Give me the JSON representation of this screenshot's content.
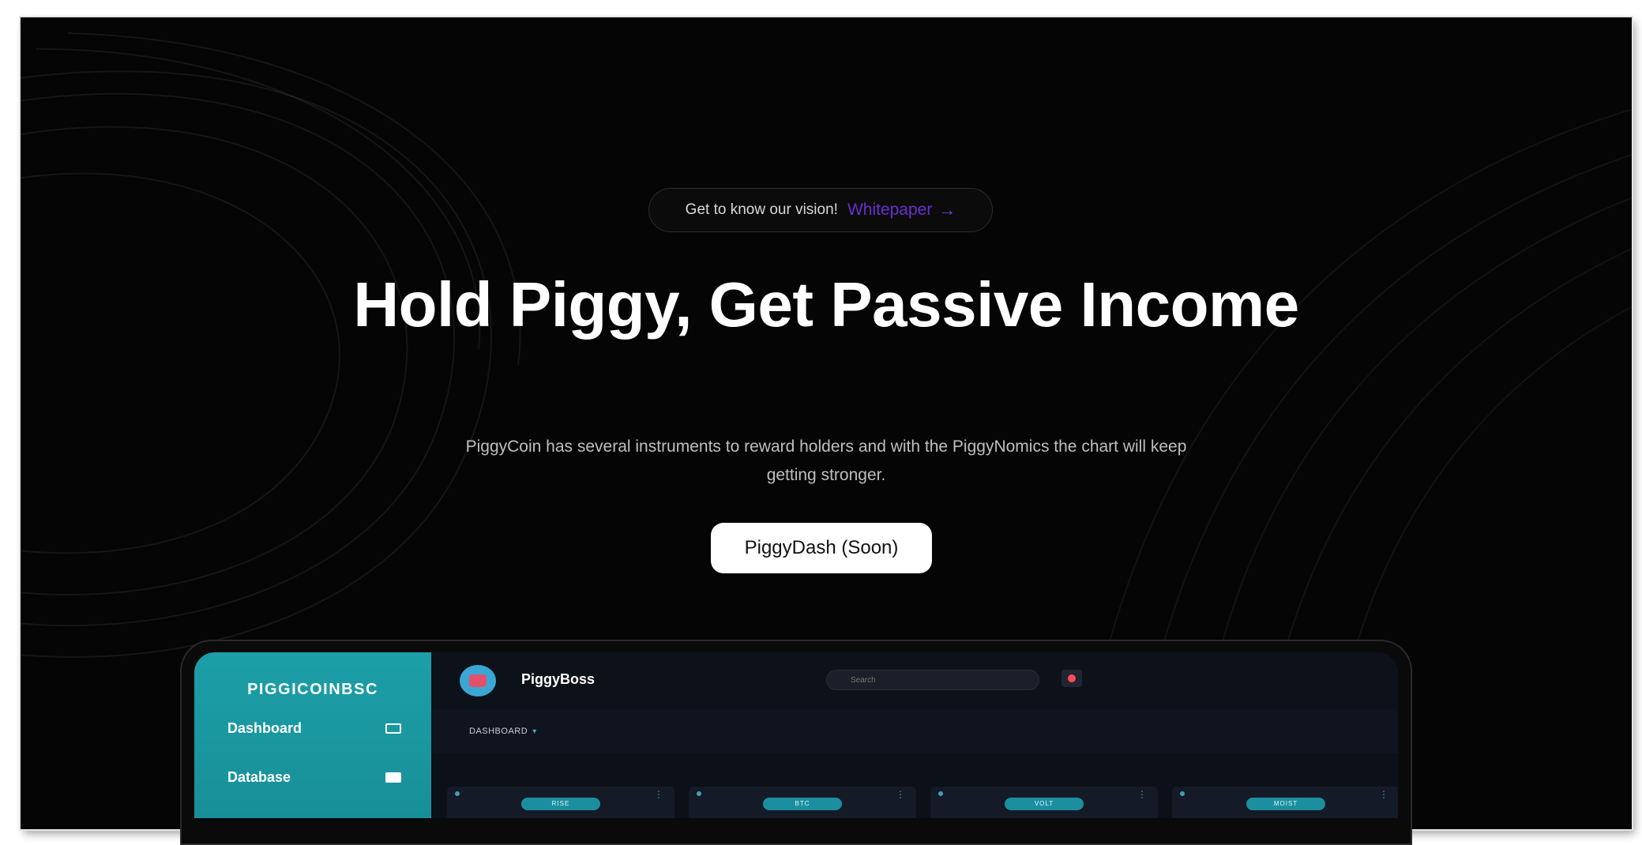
{
  "hero": {
    "pill_text": "Get to know our vision!",
    "pill_link": "Whitepaper",
    "arrow_icon": "arrow-right-icon",
    "title": "Hold Piggy, Get Passive Income",
    "subtitle": "PiggyCoin has several instruments to reward holders and with the PiggyNomics the chart will keep getting stronger.",
    "cta_label": "PiggyDash (Soon)"
  },
  "dashboard": {
    "brand": "PIGGICOINBSC",
    "username": "PiggyBoss",
    "search_placeholder": "Search",
    "breadcrumb": "DASHBOARD",
    "sidebar": {
      "items": [
        {
          "label": "Dashboard",
          "icon": "monitor-icon"
        },
        {
          "label": "Database",
          "icon": "database-icon"
        }
      ]
    },
    "cards": [
      {
        "tag": "RISE"
      },
      {
        "tag": "BTC"
      },
      {
        "tag": "VOLT"
      },
      {
        "tag": "MOIST"
      }
    ]
  },
  "colors": {
    "background": "#050505",
    "accent_purple": "#6a2fd0",
    "sidebar_teal": "#1c9fa8",
    "cta_bg": "#ffffff"
  }
}
